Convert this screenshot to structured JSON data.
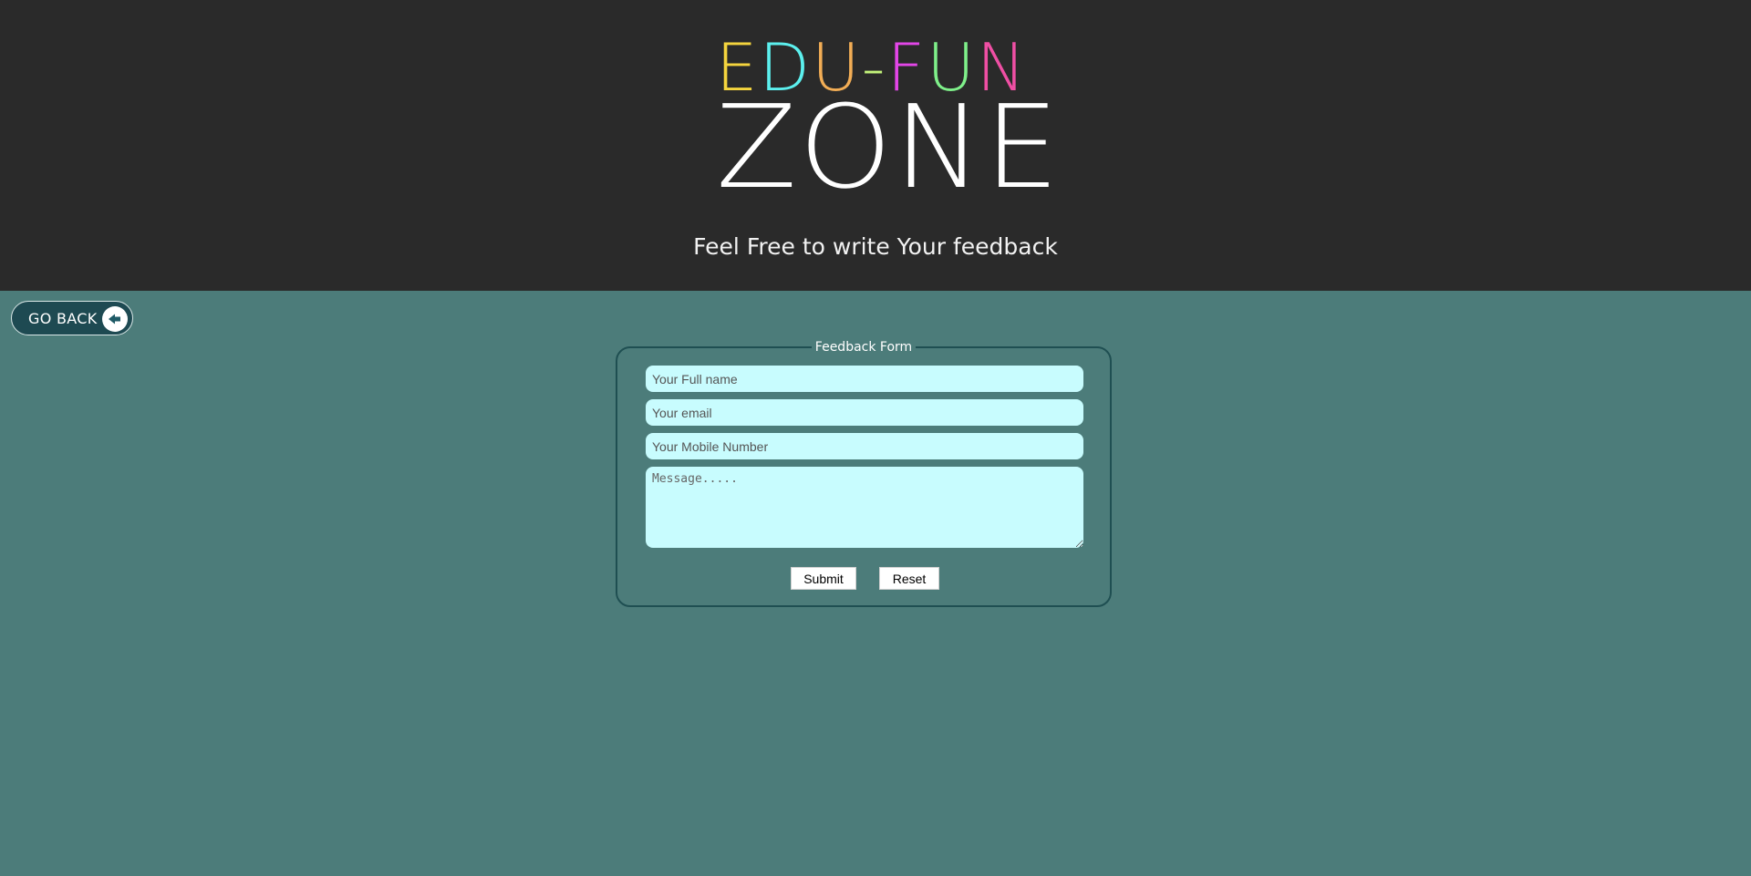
{
  "header": {
    "logo": {
      "top_letters": [
        {
          "char": "E",
          "color": "#f5d53e"
        },
        {
          "char": "D",
          "color": "#5cf0ee"
        },
        {
          "char": "U",
          "color": "#f2ad55"
        },
        {
          "char": "-",
          "color": "#c3f37a"
        },
        {
          "char": "F",
          "color": "#e346e8"
        },
        {
          "char": "U",
          "color": "#7ff08a"
        },
        {
          "char": "N",
          "color": "#ef4fa4"
        }
      ],
      "bottom": "ZONE"
    },
    "tagline": "Feel Free to write Your feedback"
  },
  "back_button": {
    "label": "GO BACK",
    "icon": "arrow-left-circle-icon"
  },
  "form": {
    "legend": "Feedback Form",
    "fields": {
      "full_name": {
        "placeholder": "Your Full name"
      },
      "email": {
        "placeholder": "Your email"
      },
      "mobile": {
        "placeholder": "Your Mobile Number"
      },
      "message": {
        "placeholder": "Message....."
      }
    },
    "buttons": {
      "submit": "Submit",
      "reset": "Reset"
    }
  },
  "colors": {
    "header_bg": "#2a2a2a",
    "page_bg": "#4c7c7a",
    "field_bg": "#c8fcfe",
    "back_button_bg": "#1e4a52"
  }
}
